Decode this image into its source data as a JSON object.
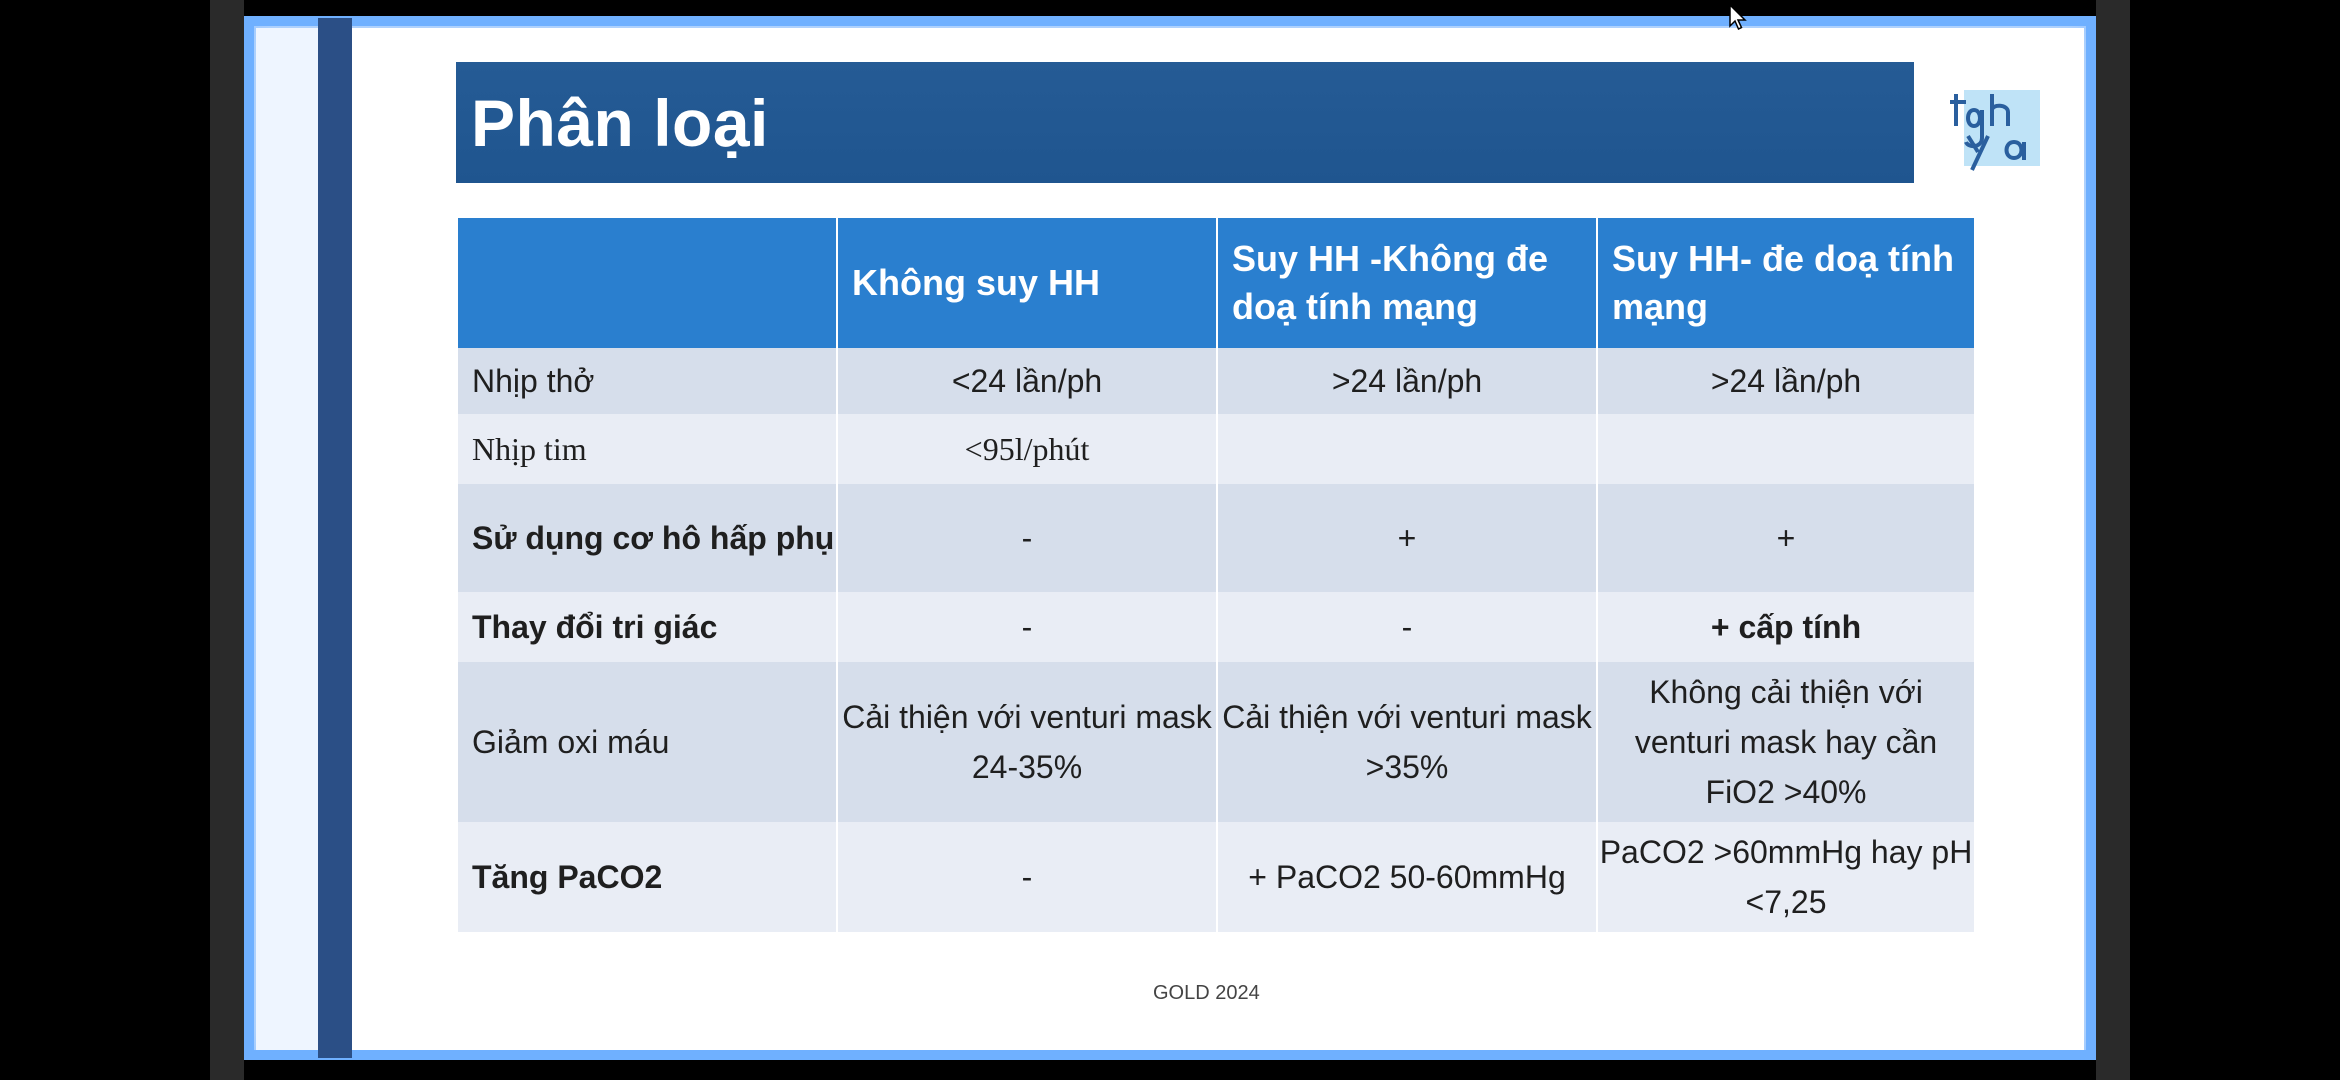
{
  "slide": {
    "title": "Phân loại",
    "footer": "GOLD 2024",
    "logo_text": "tgha"
  },
  "table": {
    "headers": [
      "",
      "Không suy HH",
      "Suy HH -Không đe doạ tính mạng",
      "Suy HH- đe doạ tính mạng"
    ],
    "rows": [
      {
        "label": "Nhịp thở",
        "cells": [
          "<24 lần/ph",
          ">24 lần/ph",
          ">24 lần/ph"
        ]
      },
      {
        "label": "Nhịp tim",
        "cells": [
          "<95l/phút",
          "",
          ""
        ]
      },
      {
        "label": "Sử dụng cơ hô hấp phụ",
        "cells": [
          "-",
          "+",
          "+"
        ]
      },
      {
        "label": "Thay đổi tri giác",
        "cells": [
          "-",
          "-",
          "+ cấp tính"
        ]
      },
      {
        "label": "Giảm oxi máu",
        "cells": [
          "Cải thiện với venturi mask 24-35%",
          "Cải thiện với venturi mask >35%",
          "Không cải thiện với venturi mask hay cần FiO2 >40%"
        ]
      },
      {
        "label": "Tăng PaCO2",
        "cells": [
          "-",
          "+ PaCO2 50-60mmHg",
          "PaCO2 >60mmHg hay pH <7,25"
        ]
      }
    ]
  },
  "colors": {
    "title_bar": "#255b95",
    "header": "#2a7fcf",
    "row_dark": "#d6deeb",
    "row_light": "#e9edf5",
    "accent_red": "#e0001b"
  }
}
